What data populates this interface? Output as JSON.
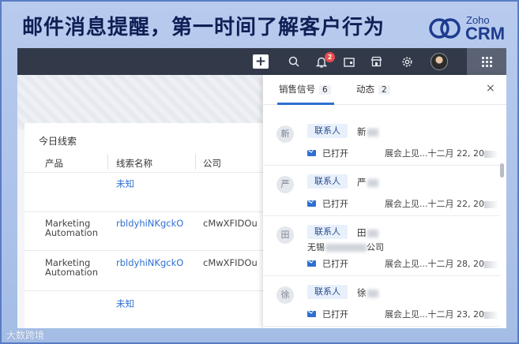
{
  "banner": {
    "headline": "邮件消息提醒，第一时间了解客户行为",
    "logo_top": "Zoho",
    "logo_bottom": "CRM",
    "brand_color": "#1d3c8f"
  },
  "topbar": {
    "notification_count": "2",
    "icons": [
      "plus-icon",
      "search-icon",
      "bell-icon",
      "calendar-icon",
      "store-icon",
      "gear-icon",
      "avatar",
      "apps-grid-icon"
    ]
  },
  "card": {
    "title": "今日线索",
    "columns": [
      "产品",
      "线索名称",
      "公司"
    ],
    "rows": [
      {
        "product": "",
        "lead": "未知",
        "company": ""
      },
      {
        "product": "Marketing Automation",
        "product_l1": "Marketing",
        "product_l2": "Automation",
        "lead": "rbldyhiNKgckO",
        "company": "cMwXFIDOu"
      },
      {
        "product": "Marketing Automation",
        "product_l1": "Marketing",
        "product_l2": "Automation",
        "lead": "rbldyhiNKgckO",
        "company": "cMwXFIDOu"
      },
      {
        "product": "",
        "lead": "未知",
        "company": ""
      }
    ]
  },
  "panel": {
    "tabs": [
      {
        "label": "销售信号",
        "count": "6",
        "active": true
      },
      {
        "label": "动态",
        "count": "2",
        "active": false
      }
    ],
    "close_label": "×",
    "items": [
      {
        "avatar": "新",
        "tag": "联系人",
        "name": "新",
        "company": "",
        "status": "已打开",
        "event": "展会上见...",
        "date": "十二月 22, 20"
      },
      {
        "avatar": "严",
        "tag": "联系人",
        "name": "严",
        "company": "",
        "status": "已打开",
        "event": "展会上见...",
        "date": "十二月 22, 20"
      },
      {
        "avatar": "田",
        "tag": "联系人",
        "name": "田",
        "company_prefix": "无锡",
        "company_suffix": "公司",
        "status": "已打开",
        "event": "展会上见...",
        "date": "十二月 28, 20"
      },
      {
        "avatar": "徐",
        "tag": "联系人",
        "name": "徐",
        "company": "",
        "status": "已打开",
        "event": "展会上见...",
        "date": "十二月 23, 20"
      }
    ]
  },
  "watermark": "大数跨境",
  "accent_color": "#2f6fd1"
}
